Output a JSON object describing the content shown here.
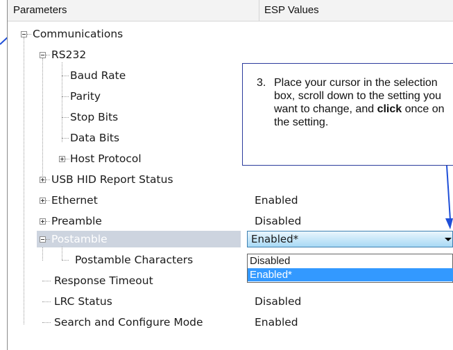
{
  "header": {
    "parameters": "Parameters",
    "esp_values": "ESP Values"
  },
  "tree": {
    "communications": "Communications",
    "rs232": "RS232",
    "baud_rate": "Baud Rate",
    "parity": "Parity",
    "stop_bits": "Stop Bits",
    "data_bits": "Data Bits",
    "host_protocol": "Host Protocol",
    "usb_hid": "USB HID Report Status",
    "ethernet": {
      "label": "Ethernet",
      "value": "Enabled"
    },
    "preamble": {
      "label": "Preamble",
      "value": "Disabled"
    },
    "postamble": {
      "label": "Postamble"
    },
    "postamble_chars": "Postamble Characters",
    "response_timeout": "Response Timeout",
    "lrc_status": {
      "label": "LRC Status",
      "value": "Disabled"
    },
    "search_configure": {
      "label": "Search and Configure Mode",
      "value": "Enabled"
    }
  },
  "dropdown": {
    "selected": "Enabled*",
    "options": [
      "Disabled",
      "Enabled*"
    ],
    "highlighted_index": 1
  },
  "callout": {
    "number": "3.",
    "text_before": "Place your cursor in the selection box, scroll down to the setting you want to change, and ",
    "text_bold": "click",
    "text_after": " once on the setting."
  },
  "colors": {
    "selection_row": "#cdd4df",
    "list_highlight": "#3399ff",
    "annotation_blue": "#2a3a9c",
    "arrow_blue": "#1f4fd8"
  }
}
